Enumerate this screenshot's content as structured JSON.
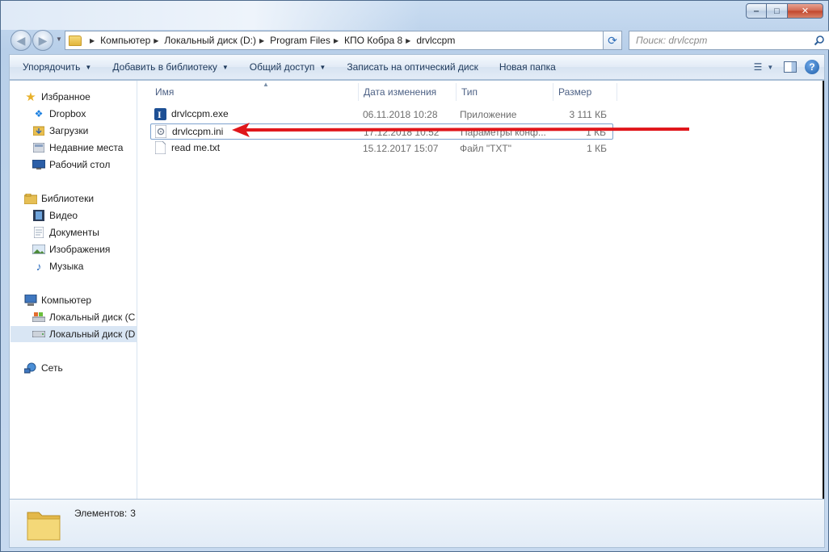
{
  "window": {
    "minimize_glyph": "‒",
    "maximize_glyph": "□",
    "close_glyph": "✕"
  },
  "address": {
    "crumbs": [
      "Компьютер",
      "Локальный диск (D:)",
      "Program Files",
      "КПО Кобра 8",
      "drvlccpm"
    ]
  },
  "search": {
    "placeholder": "Поиск: drvlccpm"
  },
  "toolbar": {
    "organize": "Упорядочить",
    "add_library": "Добавить в библиотеку",
    "share": "Общий доступ",
    "burn": "Записать на оптический диск",
    "new_folder": "Новая папка",
    "help": "?"
  },
  "sidebar": {
    "favorites": "Избранное",
    "dropbox": "Dropbox",
    "downloads": "Загрузки",
    "recent": "Недавние места",
    "desktop": "Рабочий стол",
    "libraries": "Библиотеки",
    "video": "Видео",
    "documents": "Документы",
    "images": "Изображения",
    "music": "Музыка",
    "computer": "Компьютер",
    "disk_c": "Локальный диск (C",
    "disk_d": "Локальный диск (D",
    "network": "Сеть"
  },
  "columns": {
    "name": "Имя",
    "date": "Дата изменения",
    "type": "Тип",
    "size": "Размер"
  },
  "files": [
    {
      "name": "drvlccpm.exe",
      "date": "06.11.2018 10:28",
      "type": "Приложение",
      "size": "3 111 КБ",
      "icon": "app-icon"
    },
    {
      "name": "drvlccpm.ini",
      "date": "17.12.2018 10:52",
      "type": "Параметры конф...",
      "size": "1 КБ",
      "icon": "ini-settings-icon"
    },
    {
      "name": "read me.txt",
      "date": "15.12.2017 15:07",
      "type": "Файл \"TXT\"",
      "size": "1 КБ",
      "icon": "text-file-icon"
    }
  ],
  "details": {
    "count_label": "Элементов:",
    "count_value": "3"
  },
  "colors": {
    "annotation_arrow": "#e0161b",
    "accent": "#1e395b"
  }
}
